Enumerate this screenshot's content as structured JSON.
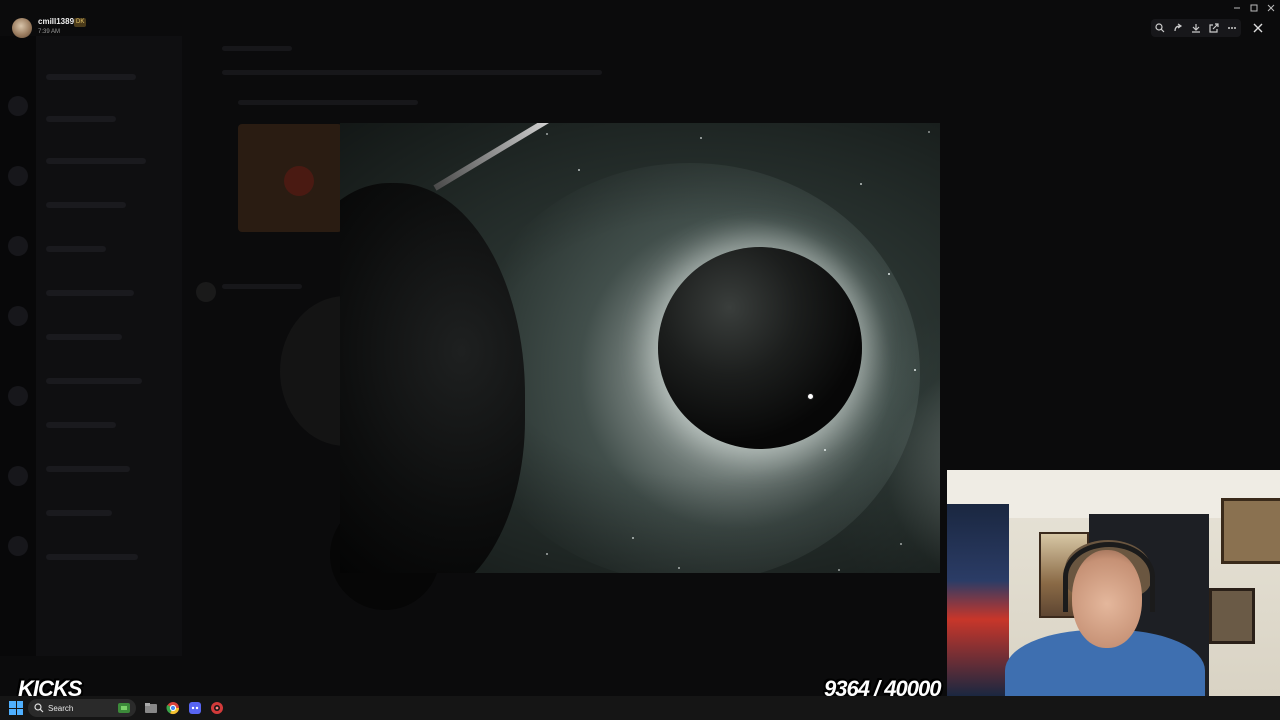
{
  "header": {
    "username": "cmill1389",
    "badge": "DK",
    "timestamp": "7:39 AM"
  },
  "toolbar": {
    "items": [
      "zoom-icon",
      "forward-icon",
      "download-icon",
      "open-external-icon",
      "more-icon"
    ],
    "close_icon": "close-icon"
  },
  "overlay": {
    "kicks_label": "KICKS",
    "kicks_counter": "9364 / 40000"
  },
  "taskbar": {
    "search_placeholder": "Search",
    "icons": [
      "windows-start-icon",
      "search-icon",
      "game-icon",
      "file-explorer-icon",
      "chrome-icon",
      "discord-icon",
      "stream-app-icon"
    ]
  },
  "colors": {
    "accent": "#4fb0ff",
    "badge_bg": "#4b3b1a",
    "badge_fg": "#e7c76c"
  }
}
